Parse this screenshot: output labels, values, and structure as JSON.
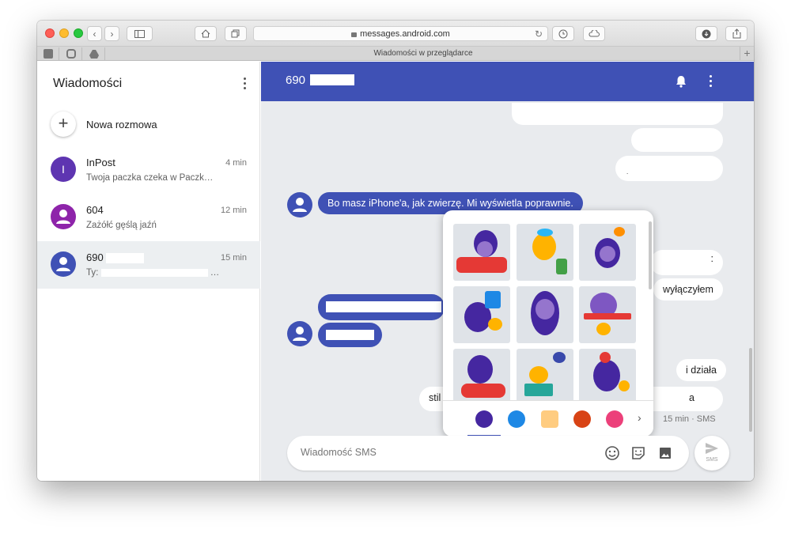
{
  "browser": {
    "url": "messages.android.com",
    "tab_title": "Wiadomości w przeglądarce"
  },
  "sidebar": {
    "title": "Wiadomości",
    "new_conversation": "Nowa rozmowa",
    "conversations": [
      {
        "name": "InPost",
        "avatar_letter": "I",
        "time": "4 min",
        "snippet": "Twoja paczka czeka w Paczk…",
        "avatar_color": "#5e35b1"
      },
      {
        "name": "604",
        "avatar_letter": "",
        "time": "12 min",
        "snippet": "Zażółć gęślą jaźń",
        "avatar_color": "#8e24aa"
      },
      {
        "name": "690",
        "avatar_letter": "",
        "time": "15 min",
        "snippet": "Ty:",
        "avatar_color": "#3f51b5"
      }
    ]
  },
  "chat": {
    "title": "690",
    "header_color": "#3f51b5",
    "messages": {
      "incoming_1": "Bo masz iPhone'a, jak zwierzę. Mi wyświetla poprawnie.",
      "outgoing_1": "wyłączyłem",
      "outgoing_2": "i działa",
      "outgoing_3_partial": "stil",
      "outgoing_3_tail": "a",
      "outgoing_colon": ":",
      "outgoing_dot": "."
    },
    "message_meta": "15 min · SMS",
    "compose_placeholder": "Wiadomość SMS",
    "send_label": "SMS"
  },
  "sticker_picker": {
    "categories": [
      "hedgehog-stickers",
      "robot-stickers",
      "toast-stickers",
      "crab-stickers",
      "bird-stickers"
    ],
    "selected_category": "hedgehog-stickers",
    "sticker_count": 9
  },
  "colors": {
    "accent": "#3f51b5",
    "background": "#e9ebee",
    "sidebar_active": "#eceff1"
  }
}
